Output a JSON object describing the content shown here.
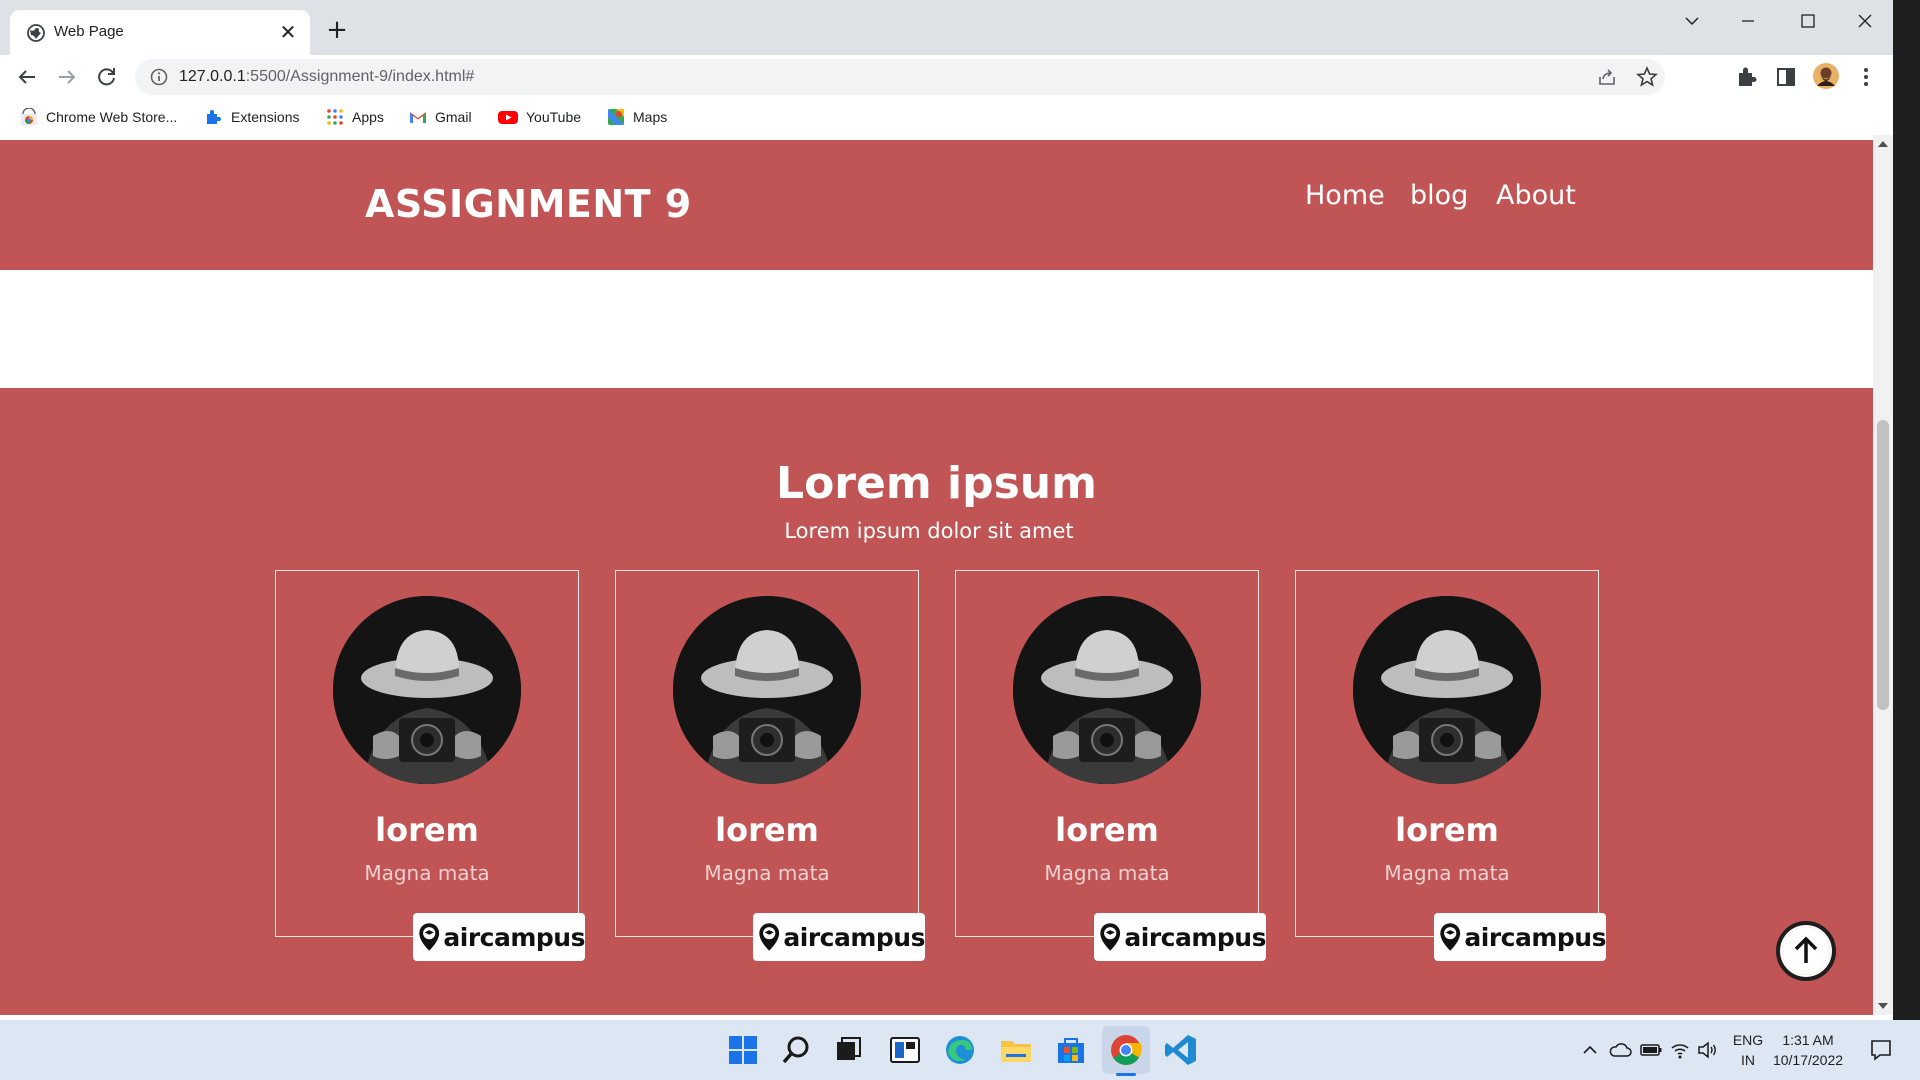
{
  "browser": {
    "tab_title": "Web Page",
    "tab_close": "✕",
    "new_tab": "+",
    "url_host": "127.0.0.1",
    "url_path": ":5500/Assignment-9/index.html#",
    "bookmarks": [
      {
        "label": "Chrome Web Store..."
      },
      {
        "label": "Extensions"
      },
      {
        "label": "Apps"
      },
      {
        "label": "Gmail"
      },
      {
        "label": "YouTube"
      },
      {
        "label": "Maps"
      }
    ]
  },
  "site": {
    "brand": "ASSIGNMENT 9",
    "nav": [
      "Home",
      "blog",
      "About"
    ],
    "section_title": "Lorem ipsum",
    "section_subtitle": "Lorem ipsum dolor sit amet",
    "cards": [
      {
        "name": "lorem",
        "role": "Magna mata",
        "badge": "aircampus"
      },
      {
        "name": "lorem",
        "role": "Magna mata",
        "badge": "aircampus"
      },
      {
        "name": "lorem",
        "role": "Magna mata",
        "badge": "aircampus"
      },
      {
        "name": "lorem",
        "role": "Magna mata",
        "badge": "aircampus"
      }
    ]
  },
  "taskbar": {
    "lang_line1": "ENG",
    "lang_line2": "IN",
    "time": "1:31 AM",
    "date": "10/17/2022"
  },
  "colors": {
    "accent": "#c15555",
    "tabstrip": "#dee1e6",
    "taskbar": "#dde6f3"
  }
}
